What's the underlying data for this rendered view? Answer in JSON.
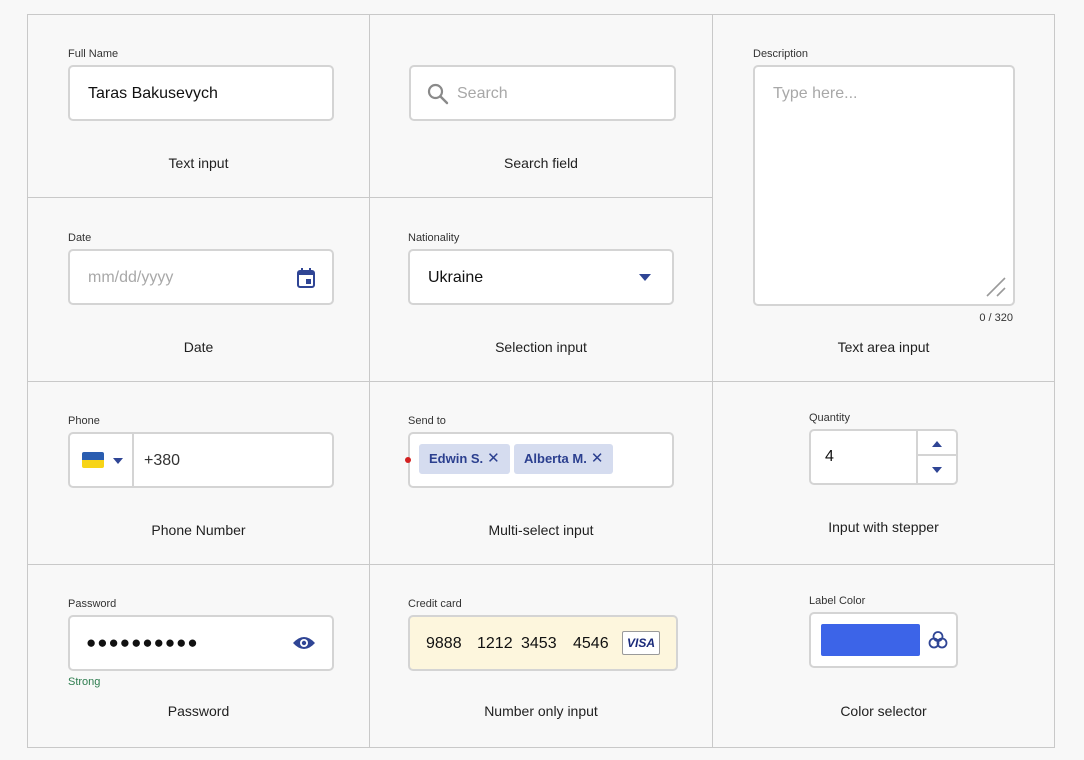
{
  "text_input": {
    "label": "Full Name",
    "value": "Taras Bakusevych",
    "caption": "Text input"
  },
  "search_field": {
    "placeholder": "Search",
    "caption": "Search field",
    "icon": "search-icon"
  },
  "description": {
    "label": "Description",
    "placeholder": "Type here...",
    "counter": "0 / 320",
    "caption": "Text area input"
  },
  "date": {
    "label": "Date",
    "placeholder": "mm/dd/yyyy",
    "caption": "Date",
    "icon": "calendar-icon"
  },
  "nationality": {
    "label": "Nationality",
    "value": "Ukraine",
    "caption": "Selection input",
    "icon": "caret-down-icon"
  },
  "phone": {
    "label": "Phone",
    "code": "+380",
    "caption": "Phone Number",
    "flag_colors": [
      "#2a5db0",
      "#f7d417"
    ]
  },
  "multi_select": {
    "label": "Send to",
    "chips": [
      "Edwin S.",
      "Alberta M."
    ],
    "remove_glyph": "✕",
    "caption": "Multi-select input"
  },
  "stepper": {
    "label": "Quantity",
    "value": "4",
    "caption": "Input with stepper"
  },
  "password": {
    "label": "Password",
    "value": "●●●●●●●●●●",
    "strength": "Strong",
    "caption": "Password",
    "strength_color": "#2e7d4f",
    "icon": "eye-icon"
  },
  "credit_card": {
    "label": "Credit card",
    "groups": [
      "9888",
      "1212",
      "3453",
      "4546"
    ],
    "brand": "VISA",
    "caption": "Number only input",
    "background": "#fdf6dd"
  },
  "color_selector": {
    "label": "Label Color",
    "swatch_color": "#3c64e8",
    "caption": "Color selector",
    "icon": "color-palette-icon"
  },
  "colors": {
    "accent": "#2f4595",
    "border": "#d4d4d4",
    "grid": "#c9c9c9"
  }
}
